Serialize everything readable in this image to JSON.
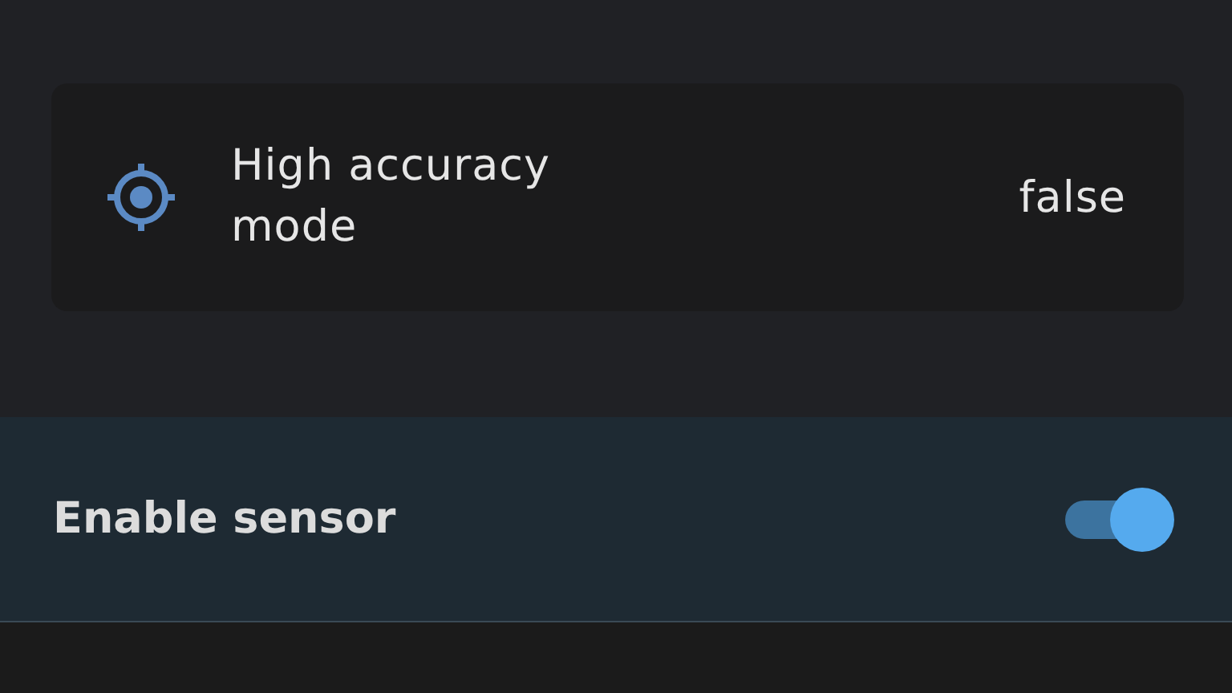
{
  "sensor_card": {
    "label": "High accuracy mode",
    "value": "false"
  },
  "enable_row": {
    "label": "Enable sensor",
    "on": true
  }
}
